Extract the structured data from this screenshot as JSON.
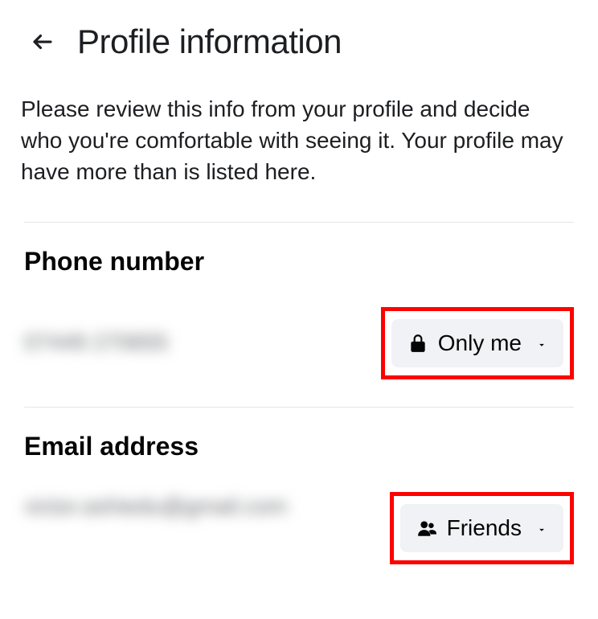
{
  "header": {
    "title": "Profile information"
  },
  "description": "Please review this info from your profile and decide who you're comfortable with seeing it. Your profile may have more than is listed here.",
  "sections": {
    "phone": {
      "title": "Phone number",
      "value": "07449 270655",
      "privacy_label": "Only me"
    },
    "email": {
      "title": "Email address",
      "value": "victor.ashiedu@gmail.com",
      "privacy_label": "Friends"
    }
  }
}
